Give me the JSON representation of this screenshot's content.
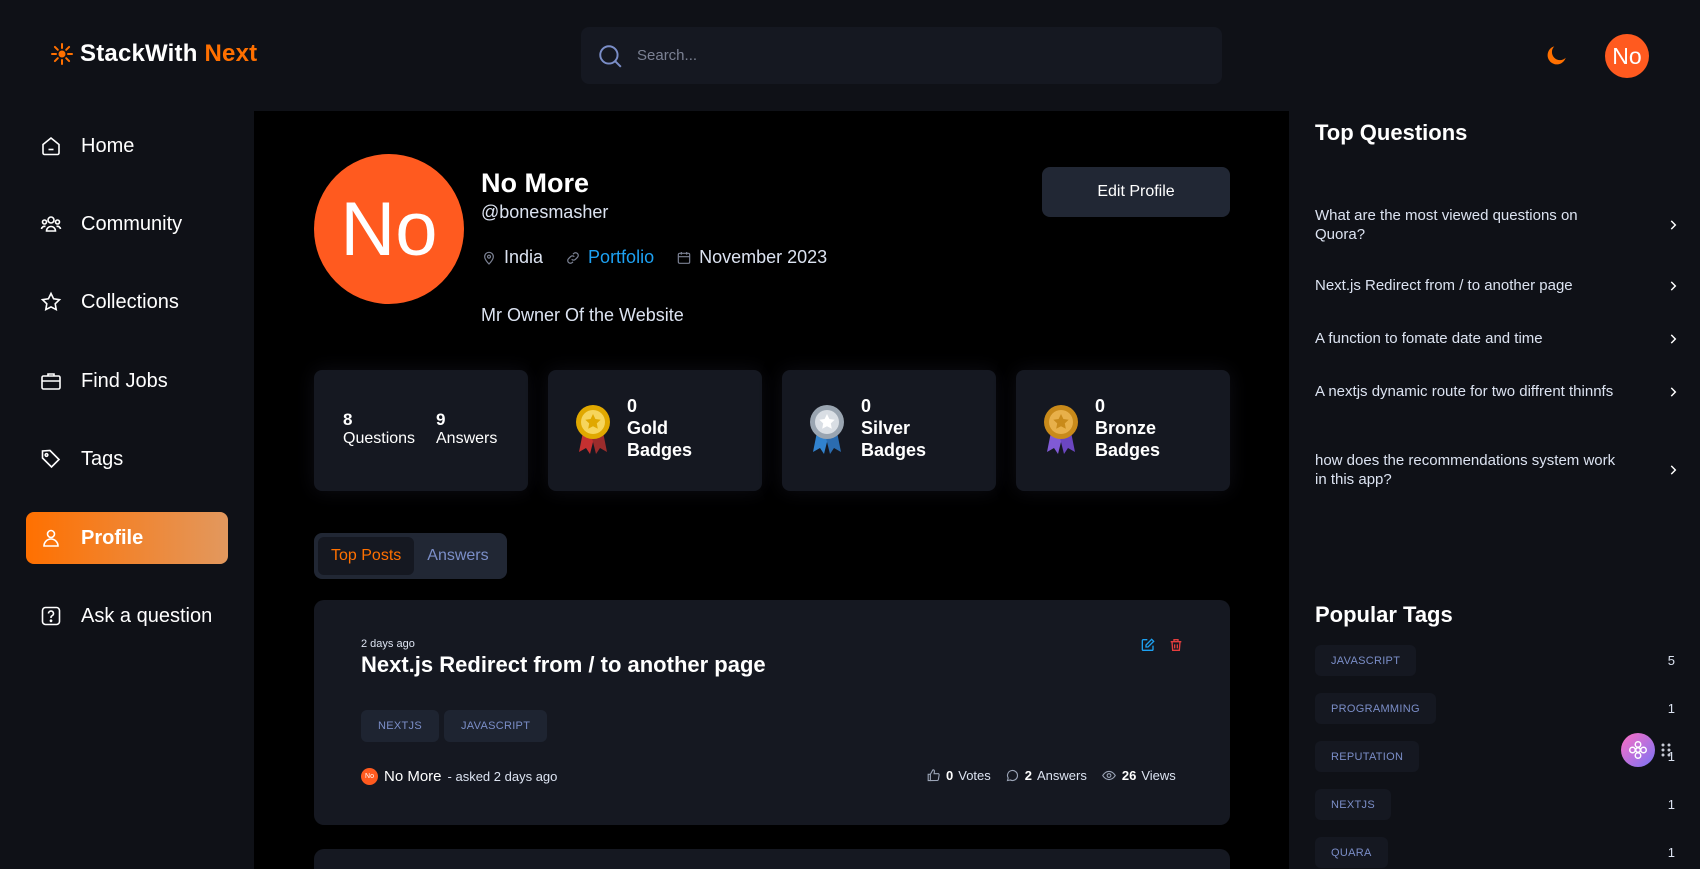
{
  "header": {
    "logo_main": "StackWith",
    "logo_accent": "Next",
    "search_placeholder": "Search...",
    "avatar_initials": "No"
  },
  "sidebar": {
    "items": [
      {
        "label": "Home",
        "icon": "home-icon"
      },
      {
        "label": "Community",
        "icon": "users-icon"
      },
      {
        "label": "Collections",
        "icon": "star-icon"
      },
      {
        "label": "Find Jobs",
        "icon": "suitcase-icon"
      },
      {
        "label": "Tags",
        "icon": "tag-icon"
      },
      {
        "label": "Profile",
        "icon": "user-icon",
        "active": true
      },
      {
        "label": "Ask a question",
        "icon": "question-icon"
      }
    ]
  },
  "profile": {
    "avatar_initials": "No",
    "name": "No More",
    "handle": "@bonesmasher",
    "location": "India",
    "portfolio": "Portfolio",
    "joined": "November 2023",
    "bio": "Mr Owner Of the Website",
    "edit_label": "Edit Profile"
  },
  "stats": {
    "questions_count": "8",
    "questions_label": "Questions",
    "answers_count": "9",
    "answers_label": "Answers",
    "gold": {
      "count": "0",
      "line1": "Gold",
      "line2": "Badges"
    },
    "silver": {
      "count": "0",
      "line1": "Silver",
      "line2": "Badges"
    },
    "bronze": {
      "count": "0",
      "line1": "Bronze",
      "line2": "Badges"
    }
  },
  "tabs": {
    "top_posts": "Top Posts",
    "answers": "Answers"
  },
  "post": {
    "ago": "2 days ago",
    "title": "Next.js Redirect from / to another page",
    "tags": [
      "NEXTJS",
      "JAVASCRIPT"
    ],
    "author_initials": "No",
    "author": "No More",
    "asked": "- asked 2 days ago",
    "votes_num": "0",
    "votes_label": "Votes",
    "answers_num": "2",
    "answers_label": "Answers",
    "views_num": "26",
    "views_label": "Views"
  },
  "right": {
    "top_questions_title": "Top Questions",
    "questions": [
      "What are the most viewed questions on Quora?",
      "Next.js Redirect from / to another page",
      "A function to fomate date and time",
      "A nextjs dynamic route for two diffrent thinnfs",
      "how does the recommendations system work in this app?"
    ],
    "popular_tags_title": "Popular Tags",
    "tags": [
      {
        "name": "JAVASCRIPT",
        "count": "5"
      },
      {
        "name": "PROGRAMMING",
        "count": "1"
      },
      {
        "name": "REPUTATION",
        "count": "1"
      },
      {
        "name": "NEXTJS",
        "count": "1"
      },
      {
        "name": "QUARA",
        "count": "1"
      }
    ]
  },
  "colors": {
    "accent": "#ff7000",
    "link": "#1da1f2",
    "tag_text": "#7b8ec8",
    "card": "#151821"
  }
}
